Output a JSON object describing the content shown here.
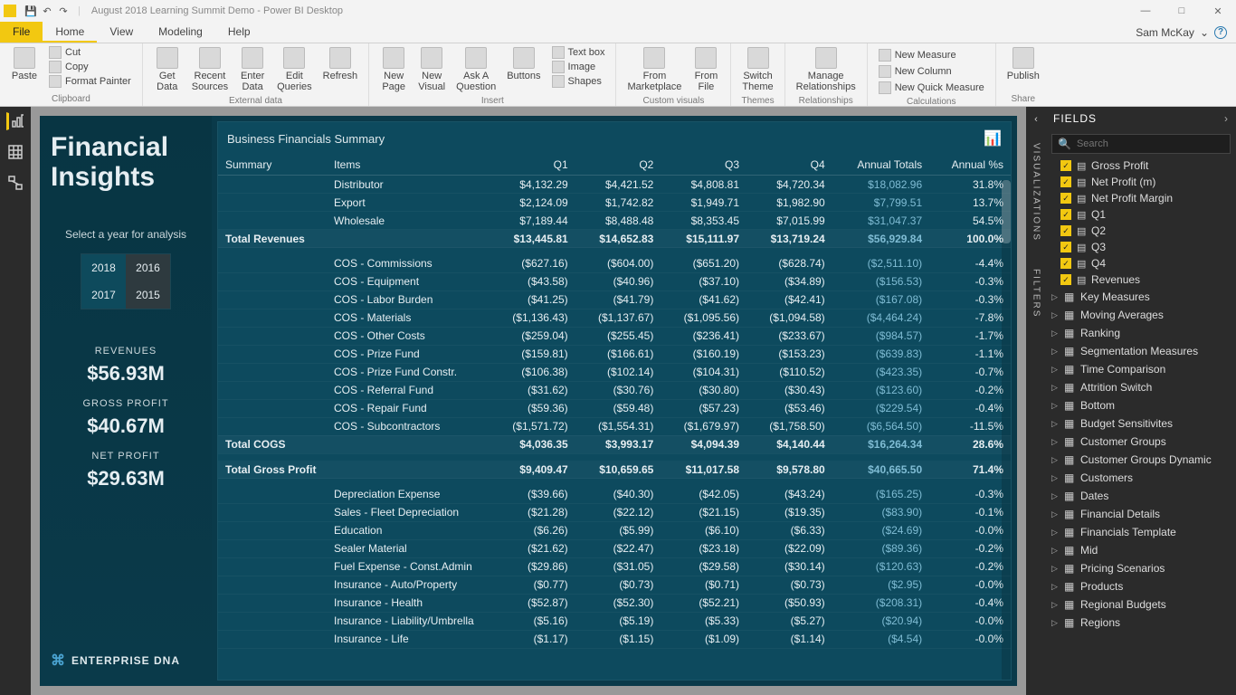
{
  "window": {
    "title": "August 2018 Learning Summit Demo - Power BI Desktop",
    "user": "Sam McKay"
  },
  "ribbon_tabs": [
    "File",
    "Home",
    "View",
    "Modeling",
    "Help"
  ],
  "ribbon": {
    "clipboard": {
      "paste": "Paste",
      "cut": "Cut",
      "copy": "Copy",
      "format": "Format Painter",
      "label": "Clipboard"
    },
    "external": {
      "get": "Get\nData",
      "recent": "Recent\nSources",
      "enter": "Enter\nData",
      "edit": "Edit\nQueries",
      "refresh": "Refresh",
      "label": "External data"
    },
    "insert": {
      "newpage": "New\nPage",
      "newvis": "New\nVisual",
      "ask": "Ask A\nQuestion",
      "buttons": "Buttons",
      "textbox": "Text box",
      "image": "Image",
      "shapes": "Shapes",
      "label": "Insert"
    },
    "custom": {
      "market": "From\nMarketplace",
      "file": "From\nFile",
      "label": "Custom visuals"
    },
    "themes": {
      "switch": "Switch\nTheme",
      "label": "Themes"
    },
    "rel": {
      "manage": "Manage\nRelationships",
      "label": "Relationships"
    },
    "calc": {
      "measure": "New Measure",
      "column": "New Column",
      "quick": "New Quick Measure",
      "label": "Calculations"
    },
    "share": {
      "publish": "Publish",
      "label": "Share"
    }
  },
  "report": {
    "title_a": "Financial",
    "title_b": "Insights",
    "select_label": "Select a year for analysis",
    "years": [
      "2018",
      "2016",
      "2017",
      "2015"
    ],
    "kpis": [
      {
        "label": "REVENUES",
        "value": "$56.93M"
      },
      {
        "label": "GROSS PROFIT",
        "value": "$40.67M"
      },
      {
        "label": "NET PROFIT",
        "value": "$29.63M"
      }
    ],
    "brand": "ENTERPRISE DNA",
    "visual_title": "Business Financials Summary",
    "columns": [
      "Summary",
      "Items",
      "Q1",
      "Q2",
      "Q3",
      "Q4",
      "Annual Totals",
      "Annual %s"
    ],
    "rows": [
      {
        "t": "item",
        "s": "",
        "i": "Distributor",
        "q": [
          "$4,132.29",
          "$4,421.52",
          "$4,808.81",
          "$4,720.34"
        ],
        "a": "$18,082.96",
        "p": "31.8%"
      },
      {
        "t": "item",
        "s": "",
        "i": "Export",
        "q": [
          "$2,124.09",
          "$1,742.82",
          "$1,949.71",
          "$1,982.90"
        ],
        "a": "$7,799.51",
        "p": "13.7%"
      },
      {
        "t": "item",
        "s": "",
        "i": "Wholesale",
        "q": [
          "$7,189.44",
          "$8,488.48",
          "$8,353.45",
          "$7,015.99"
        ],
        "a": "$31,047.37",
        "p": "54.5%"
      },
      {
        "t": "section",
        "s": "Total Revenues",
        "i": "",
        "q": [
          "$13,445.81",
          "$14,652.83",
          "$15,111.97",
          "$13,719.24"
        ],
        "a": "$56,929.84",
        "p": "100.0%"
      },
      {
        "t": "spacer"
      },
      {
        "t": "item",
        "s": "",
        "i": "COS - Commissions",
        "q": [
          "($627.16)",
          "($604.00)",
          "($651.20)",
          "($628.74)"
        ],
        "a": "($2,511.10)",
        "p": "-4.4%"
      },
      {
        "t": "item",
        "s": "",
        "i": "COS - Equipment",
        "q": [
          "($43.58)",
          "($40.96)",
          "($37.10)",
          "($34.89)"
        ],
        "a": "($156.53)",
        "p": "-0.3%"
      },
      {
        "t": "item",
        "s": "",
        "i": "COS - Labor Burden",
        "q": [
          "($41.25)",
          "($41.79)",
          "($41.62)",
          "($42.41)"
        ],
        "a": "($167.08)",
        "p": "-0.3%"
      },
      {
        "t": "item",
        "s": "",
        "i": "COS - Materials",
        "q": [
          "($1,136.43)",
          "($1,137.67)",
          "($1,095.56)",
          "($1,094.58)"
        ],
        "a": "($4,464.24)",
        "p": "-7.8%"
      },
      {
        "t": "item",
        "s": "",
        "i": "COS - Other Costs",
        "q": [
          "($259.04)",
          "($255.45)",
          "($236.41)",
          "($233.67)"
        ],
        "a": "($984.57)",
        "p": "-1.7%"
      },
      {
        "t": "item",
        "s": "",
        "i": "COS - Prize Fund",
        "q": [
          "($159.81)",
          "($166.61)",
          "($160.19)",
          "($153.23)"
        ],
        "a": "($639.83)",
        "p": "-1.1%"
      },
      {
        "t": "item",
        "s": "",
        "i": "COS - Prize Fund Constr.",
        "q": [
          "($106.38)",
          "($102.14)",
          "($104.31)",
          "($110.52)"
        ],
        "a": "($423.35)",
        "p": "-0.7%"
      },
      {
        "t": "item",
        "s": "",
        "i": "COS - Referral Fund",
        "q": [
          "($31.62)",
          "($30.76)",
          "($30.80)",
          "($30.43)"
        ],
        "a": "($123.60)",
        "p": "-0.2%"
      },
      {
        "t": "item",
        "s": "",
        "i": "COS - Repair Fund",
        "q": [
          "($59.36)",
          "($59.48)",
          "($57.23)",
          "($53.46)"
        ],
        "a": "($229.54)",
        "p": "-0.4%"
      },
      {
        "t": "item",
        "s": "",
        "i": "COS - Subcontractors",
        "q": [
          "($1,571.72)",
          "($1,554.31)",
          "($1,679.97)",
          "($1,758.50)"
        ],
        "a": "($6,564.50)",
        "p": "-11.5%"
      },
      {
        "t": "section",
        "s": "Total COGS",
        "i": "",
        "q": [
          "$4,036.35",
          "$3,993.17",
          "$4,094.39",
          "$4,140.44"
        ],
        "a": "$16,264.34",
        "p": "28.6%"
      },
      {
        "t": "spacer"
      },
      {
        "t": "section",
        "s": "Total Gross Profit",
        "i": "",
        "q": [
          "$9,409.47",
          "$10,659.65",
          "$11,017.58",
          "$9,578.80"
        ],
        "a": "$40,665.50",
        "p": "71.4%"
      },
      {
        "t": "spacer"
      },
      {
        "t": "item",
        "s": "",
        "i": "Depreciation Expense",
        "q": [
          "($39.66)",
          "($40.30)",
          "($42.05)",
          "($43.24)"
        ],
        "a": "($165.25)",
        "p": "-0.3%"
      },
      {
        "t": "item",
        "s": "",
        "i": "Sales - Fleet Depreciation",
        "q": [
          "($21.28)",
          "($22.12)",
          "($21.15)",
          "($19.35)"
        ],
        "a": "($83.90)",
        "p": "-0.1%"
      },
      {
        "t": "item",
        "s": "",
        "i": "Education",
        "q": [
          "($6.26)",
          "($5.99)",
          "($6.10)",
          "($6.33)"
        ],
        "a": "($24.69)",
        "p": "-0.0%"
      },
      {
        "t": "item",
        "s": "",
        "i": "Sealer Material",
        "q": [
          "($21.62)",
          "($22.47)",
          "($23.18)",
          "($22.09)"
        ],
        "a": "($89.36)",
        "p": "-0.2%"
      },
      {
        "t": "item",
        "s": "",
        "i": "Fuel Expense - Const.Admin",
        "q": [
          "($29.86)",
          "($31.05)",
          "($29.58)",
          "($30.14)"
        ],
        "a": "($120.63)",
        "p": "-0.2%"
      },
      {
        "t": "item",
        "s": "",
        "i": "Insurance - Auto/Property",
        "q": [
          "($0.77)",
          "($0.73)",
          "($0.71)",
          "($0.73)"
        ],
        "a": "($2.95)",
        "p": "-0.0%"
      },
      {
        "t": "item",
        "s": "",
        "i": "Insurance - Health",
        "q": [
          "($52.87)",
          "($52.30)",
          "($52.21)",
          "($50.93)"
        ],
        "a": "($208.31)",
        "p": "-0.4%"
      },
      {
        "t": "item",
        "s": "",
        "i": "Insurance - Liability/Umbrella",
        "q": [
          "($5.16)",
          "($5.19)",
          "($5.33)",
          "($5.27)"
        ],
        "a": "($20.94)",
        "p": "-0.0%"
      },
      {
        "t": "item",
        "s": "",
        "i": "Insurance - Life",
        "q": [
          "($1.17)",
          "($1.15)",
          "($1.09)",
          "($1.14)"
        ],
        "a": "($4.54)",
        "p": "-0.0%"
      }
    ]
  },
  "panes": {
    "viz": "VISUALIZATIONS",
    "filters": "FILTERS"
  },
  "fields": {
    "title": "FIELDS",
    "search_placeholder": "Search",
    "checked": [
      {
        "label": "Gross Profit",
        "ico": "▤"
      },
      {
        "label": "Net Profit (m)",
        "ico": "▤"
      },
      {
        "label": "Net Profit Margin",
        "ico": "▤"
      },
      {
        "label": "Q1",
        "ico": "▤"
      },
      {
        "label": "Q2",
        "ico": "▤"
      },
      {
        "label": "Q3",
        "ico": "▤"
      },
      {
        "label": "Q4",
        "ico": "▤"
      },
      {
        "label": "Revenues",
        "ico": "▤"
      }
    ],
    "tables": [
      "Key Measures",
      "Moving Averages",
      "Ranking",
      "Segmentation Measures",
      "Time Comparison",
      "Attrition Switch",
      "Bottom",
      "Budget Sensitivites",
      "Customer Groups",
      "Customer Groups Dynamic",
      "Customers",
      "Dates",
      "Financial Details",
      "Financials Template",
      "Mid",
      "Pricing Scenarios",
      "Products",
      "Regional Budgets",
      "Regions"
    ]
  }
}
